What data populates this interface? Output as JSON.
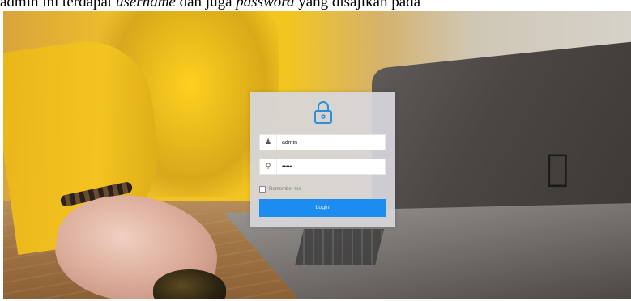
{
  "document": {
    "text_before": "admin ini terdapat ",
    "italic_1": "username",
    "text_middle": " dan juga ",
    "italic_2": "password",
    "text_after": " yang disajikan pada"
  },
  "login": {
    "username_value": "admin",
    "password_value": "•••••",
    "remember_label": "Remember me",
    "login_button": "Login",
    "icons": {
      "lock": "lock-icon",
      "user": "user-icon",
      "key": "key-icon",
      "apple": "apple-logo-icon"
    },
    "colors": {
      "button": "#1d8cf0",
      "lock": "#2e8fd8",
      "card": "#d6d6dc"
    }
  }
}
